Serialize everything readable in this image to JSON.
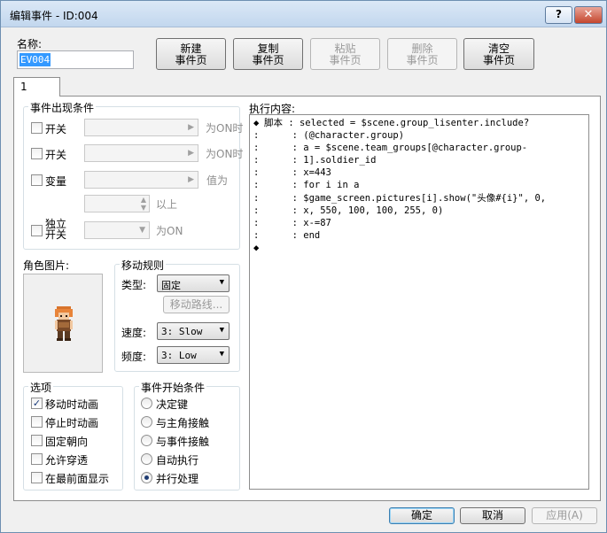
{
  "window": {
    "title": "编辑事件 - ID:004",
    "help_label": "?",
    "close_label": "✕"
  },
  "name": {
    "label": "名称:",
    "value": "EV004"
  },
  "toolbar": {
    "new_page": [
      "新建",
      "事件页"
    ],
    "copy_page": [
      "复制",
      "事件页"
    ],
    "paste_page": [
      "粘贴",
      "事件页"
    ],
    "delete_page": [
      "删除",
      "事件页"
    ],
    "clear_page": [
      "清空",
      "事件页"
    ]
  },
  "tabs": [
    {
      "label": "1"
    }
  ],
  "conditions": {
    "title": "事件出现条件",
    "switch1_label": "开关",
    "switch1_suffix": "为ON时",
    "switch2_label": "开关",
    "switch2_suffix": "为ON时",
    "variable_label": "变量",
    "variable_suffix": "值为",
    "above_label": "以上",
    "self_switch_label_1": "独立",
    "self_switch_label_2": "开关",
    "self_switch_suffix": "为ON"
  },
  "graphic": {
    "title": "角色图片:"
  },
  "movement": {
    "title": "移动规则",
    "type_label": "类型:",
    "type_value": "固定",
    "route_label": "移动路线...",
    "speed_label": "速度:",
    "speed_value": "3: Slow",
    "freq_label": "频度:",
    "freq_value": "3: Low"
  },
  "options": {
    "title": "选项",
    "items": [
      {
        "label": "移动时动画",
        "checked": true
      },
      {
        "label": "停止时动画",
        "checked": false
      },
      {
        "label": "固定朝向",
        "checked": false
      },
      {
        "label": "允许穿透",
        "checked": false
      },
      {
        "label": "在最前面显示",
        "checked": false
      }
    ]
  },
  "trigger": {
    "title": "事件开始条件",
    "items": [
      {
        "label": "决定键",
        "selected": false
      },
      {
        "label": "与主角接触",
        "selected": false
      },
      {
        "label": "与事件接触",
        "selected": false
      },
      {
        "label": "自动执行",
        "selected": false
      },
      {
        "label": "并行处理",
        "selected": true
      }
    ]
  },
  "contents": {
    "title": "执行内容:",
    "lines": [
      {
        "mark": "◆",
        "text": "脚本 : selected = $scene.group_lisenter.include?"
      },
      {
        "mark": ":",
        "text": "     : (@character.group)"
      },
      {
        "mark": ":",
        "text": "     : a = $scene.team_groups[@character.group-"
      },
      {
        "mark": ":",
        "text": "     : 1].soldier_id"
      },
      {
        "mark": ":",
        "text": "     : x=443"
      },
      {
        "mark": ":",
        "text": "     : for i in a"
      },
      {
        "mark": ":",
        "text": "     : $game_screen.pictures[i].show(\"头像#{i}\", 0,"
      },
      {
        "mark": ":",
        "text": "     : x, 550, 100, 100, 255, 0)"
      },
      {
        "mark": ":",
        "text": "     : x-=87"
      },
      {
        "mark": ":",
        "text": "     : end"
      },
      {
        "mark": "◆",
        "text": ""
      }
    ]
  },
  "buttons": {
    "ok": "确定",
    "cancel": "取消",
    "apply": "应用(A)"
  }
}
